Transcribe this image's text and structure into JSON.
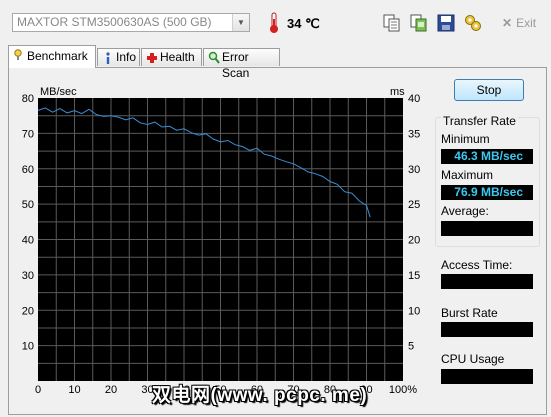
{
  "toolbar": {
    "drive": "MAXTOR STM3500630AS (500 GB)",
    "temperature": "34 ℃",
    "exit_label": "Exit",
    "icons": [
      "thermometer-icon",
      "copy-icon",
      "copy-screen-icon",
      "save-icon",
      "options-icon",
      "exit-icon"
    ]
  },
  "tabs": [
    {
      "label": "Benchmark",
      "icon": "benchmark-icon",
      "active": true
    },
    {
      "label": "Info",
      "icon": "info-icon",
      "active": false
    },
    {
      "label": "Health",
      "icon": "health-icon",
      "active": false
    },
    {
      "label": "Error Scan",
      "icon": "error-scan-icon",
      "active": false
    }
  ],
  "chart_data": {
    "type": "line",
    "ylabel_left": "MB/sec",
    "ylabel_right": "ms",
    "ylim_left": [
      0,
      80
    ],
    "ylim_right": [
      0,
      40
    ],
    "xlim": [
      0,
      100
    ],
    "y_ticks_left": [
      "80",
      "70",
      "60",
      "50",
      "40",
      "30",
      "20",
      "10"
    ],
    "y_ticks_right": [
      "40",
      "35",
      "30",
      "25",
      "20",
      "15",
      "10",
      "5"
    ],
    "x_ticks": [
      "0",
      "10",
      "20",
      "30",
      "40",
      "50",
      "60",
      "70",
      "80",
      "90",
      "100%"
    ],
    "grid": true,
    "background": "#000000",
    "line_color": "#3a8fd8",
    "series": [
      {
        "x": [
          0,
          2,
          4,
          6,
          8,
          10,
          12,
          14,
          16,
          18,
          20,
          22,
          24,
          26,
          28,
          30,
          32,
          34,
          36,
          38,
          40,
          42,
          44,
          46,
          48,
          50,
          52,
          54,
          56,
          58,
          60,
          62,
          64,
          66,
          68,
          70,
          72,
          74,
          76,
          78,
          80,
          82,
          84,
          86,
          88,
          90,
          91
        ],
        "values": [
          76.5,
          77.2,
          76.0,
          77.0,
          75.8,
          76.4,
          75.6,
          76.8,
          75.3,
          74.8,
          75.0,
          74.6,
          73.8,
          74.4,
          73.0,
          72.5,
          73.2,
          71.8,
          72.0,
          70.9,
          71.3,
          70.2,
          69.5,
          69.9,
          68.4,
          67.6,
          68.0,
          66.8,
          66.3,
          65.2,
          65.8,
          64.1,
          63.6,
          62.7,
          62.0,
          61.4,
          60.3,
          59.1,
          58.6,
          57.8,
          56.4,
          55.6,
          53.5,
          53.1,
          50.9,
          49.6,
          46.3
        ]
      }
    ]
  },
  "side": {
    "stop_label": "Stop",
    "transfer_rate_title": "Transfer Rate",
    "minimum_label": "Minimum",
    "minimum_value": "46.3 MB/sec",
    "maximum_label": "Maximum",
    "maximum_value": "76.9 MB/sec",
    "average_label": "Average:",
    "access_time_label": "Access Time:",
    "burst_rate_label": "Burst Rate",
    "cpu_usage_label": "CPU Usage"
  },
  "watermark": "双电网(www. pcpc. me)"
}
